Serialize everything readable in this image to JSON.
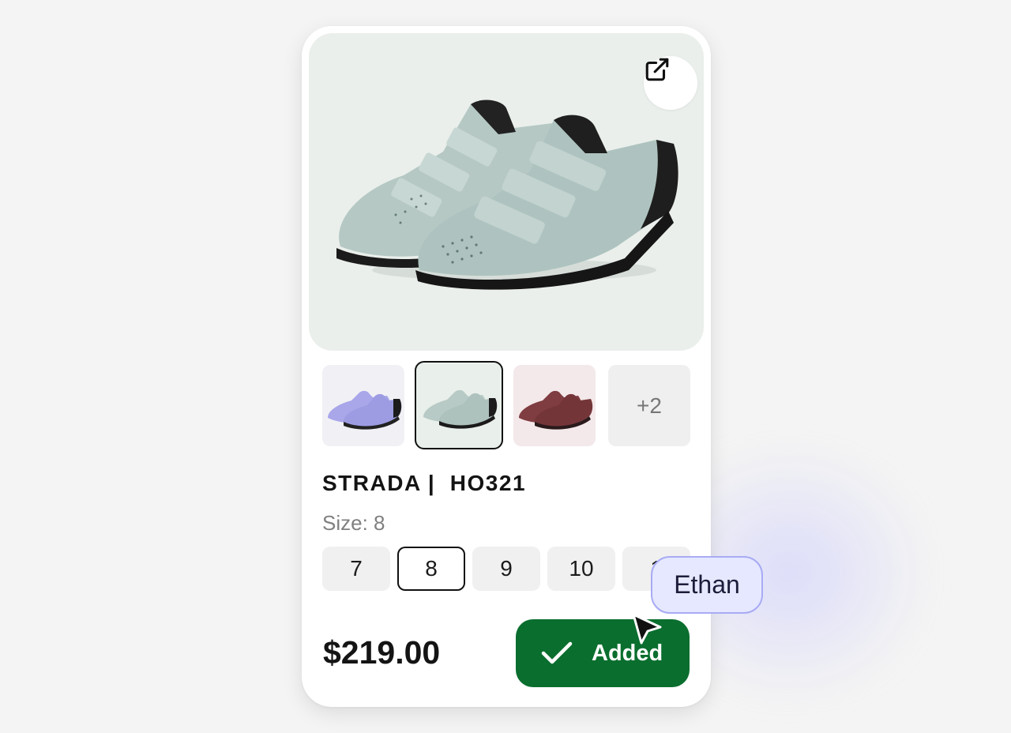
{
  "product": {
    "title": "STRADA |  HO321",
    "size_label": "Size: 8",
    "price": "$219.00",
    "external_link_icon": "external-link-icon"
  },
  "thumbnails": {
    "more_label": "+2"
  },
  "sizes": [
    "7",
    "8",
    "9",
    "10",
    "1"
  ],
  "selected_size": "8",
  "cart_button": {
    "label": "Added",
    "icon": "checkmark-icon",
    "color": "#0a6e2e"
  },
  "collaborator": {
    "name": "Ethan",
    "cursor_icon": "cursor-arrow-icon"
  },
  "colors": {
    "shoe_mint": "#b3c7c3",
    "shoe_lavender": "#a3a2e6",
    "shoe_maroon": "#7a3a3e"
  }
}
